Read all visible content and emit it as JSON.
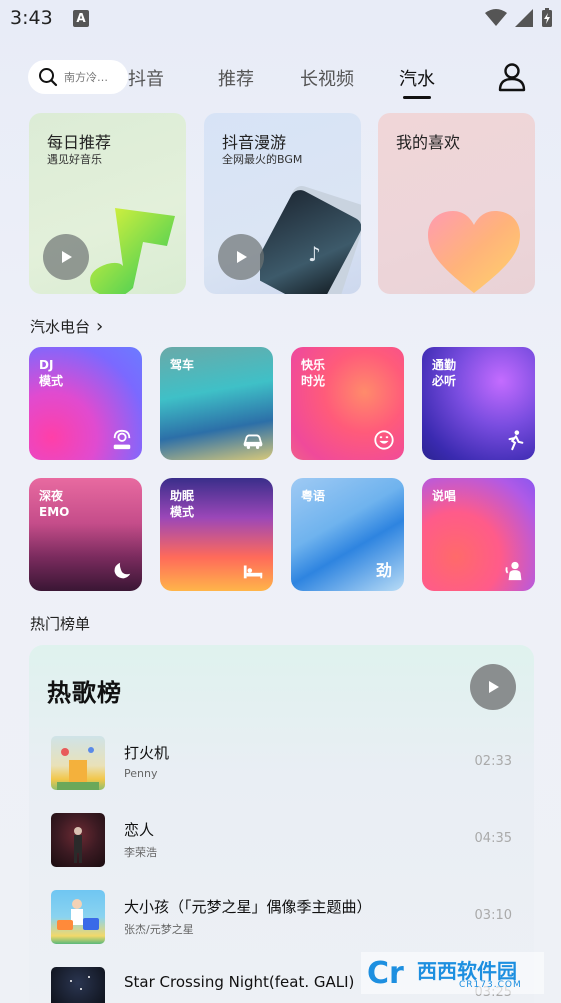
{
  "status_bar": {
    "time": "3:43",
    "a_icon": "A"
  },
  "nav": {
    "search_placeholder": "南方冷…",
    "tabs": [
      "抖音",
      "推荐",
      "长视频",
      "汽水"
    ],
    "active_tab": "汽水"
  },
  "features": [
    {
      "title": "每日推荐",
      "subtitle": "遇见好音乐"
    },
    {
      "title": "抖音漫游",
      "subtitle": "全网最火的BGM"
    },
    {
      "title": "我的喜欢",
      "subtitle": ""
    }
  ],
  "radio_section": {
    "title": "汽水电台",
    "chevron": "›"
  },
  "radios": [
    {
      "label": "DJ\n模式",
      "icon": "dj-icon"
    },
    {
      "label": "驾车",
      "icon": "car-icon"
    },
    {
      "label": "快乐\n时光",
      "icon": "smile-icon"
    },
    {
      "label": "通勤\n必听",
      "icon": "walk-icon"
    },
    {
      "label": "深夜\nEMO",
      "icon": "moon-icon"
    },
    {
      "label": "助眠\n模式",
      "icon": "bed-icon"
    },
    {
      "label": "粤语",
      "icon": "cantonese-icon",
      "icon_text": "劲"
    },
    {
      "label": "说唱",
      "icon": "rap-icon"
    }
  ],
  "hot_section": {
    "title": "热门榜单"
  },
  "hot_chart": {
    "title": "热歌榜",
    "songs": [
      {
        "name": "打火机",
        "artist": "Penny",
        "duration": "02:33"
      },
      {
        "name": "恋人",
        "artist": "李荣浩",
        "duration": "04:35"
      },
      {
        "name": "大小孩（「元梦之星」偶像季主题曲）",
        "artist": "张杰/元梦之星",
        "duration": "03:10"
      },
      {
        "name": "Star Crossing Night(feat. GALI)",
        "artist": "",
        "duration": "03:25"
      }
    ]
  },
  "watermark": {
    "brand": "西西软件园",
    "url": "CR173.COM"
  }
}
